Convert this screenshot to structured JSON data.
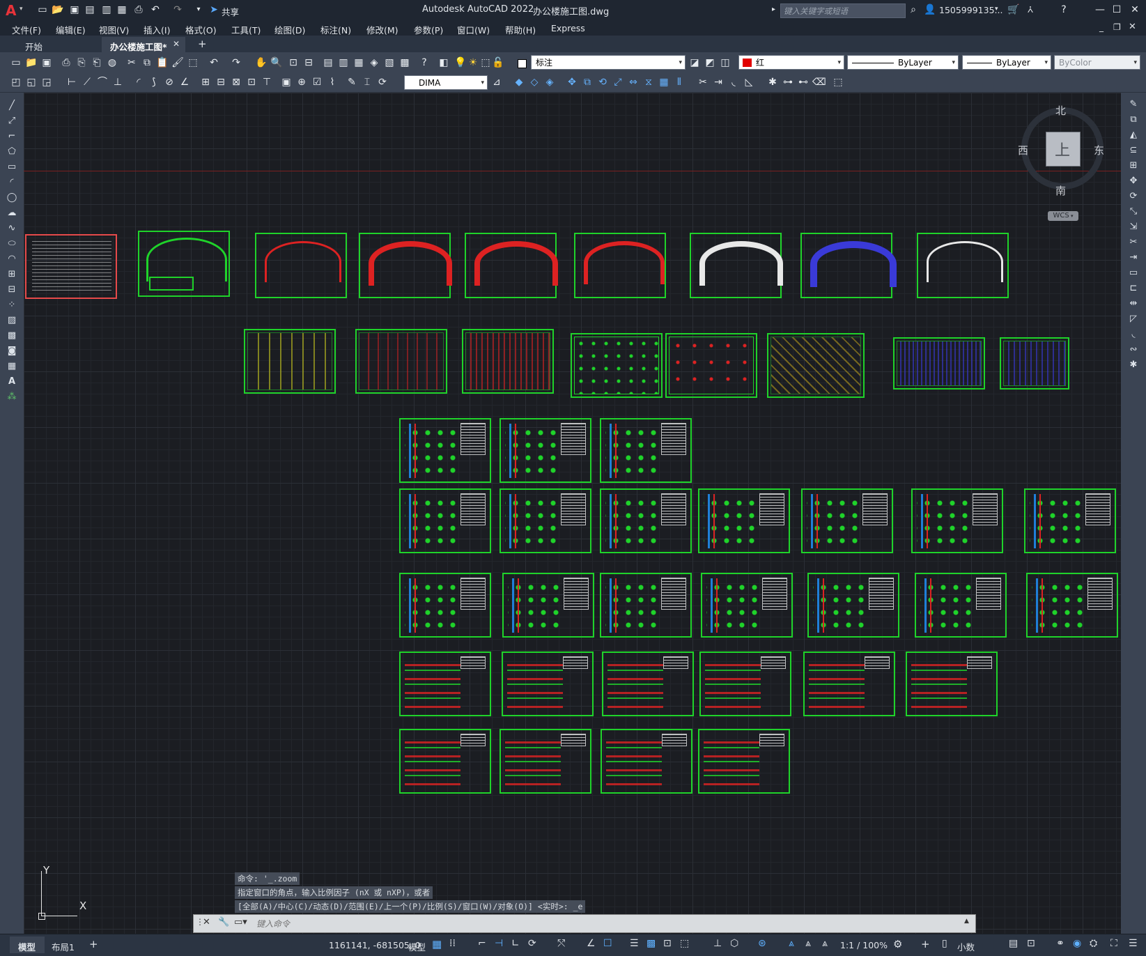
{
  "app": {
    "title": "Autodesk AutoCAD 2022",
    "filename": "办公楼施工图.dwg",
    "search_placeholder": "键入关键字或短语",
    "user": "1505999135...",
    "share_label": "共享",
    "logo": "A"
  },
  "menu": [
    "文件(F)",
    "编辑(E)",
    "视图(V)",
    "插入(I)",
    "格式(O)",
    "工具(T)",
    "绘图(D)",
    "标注(N)",
    "修改(M)",
    "参数(P)",
    "窗口(W)",
    "帮助(H)",
    "Express"
  ],
  "tabs": [
    {
      "label": "开始",
      "active": false
    },
    {
      "label": "办公楼施工图*",
      "active": true
    }
  ],
  "toolbar": {
    "layer_value": "标注",
    "color_value": "红",
    "linetype_value": "ByLayer",
    "lineweight_value": "ByLayer",
    "plotstyle_value": "ByColor",
    "dimstyle_value": "DIMA"
  },
  "viewcube": {
    "north": "北",
    "south": "南",
    "east": "东",
    "west": "西",
    "face": "上",
    "wcs": "WCS"
  },
  "ucs": {
    "x": "X",
    "y": "Y"
  },
  "command": {
    "history": [
      "命令: '_.zoom",
      "指定窗口的角点，输入比例因子 (nX 或 nXP)，或者",
      "[全部(A)/中心(C)/动态(D)/范围(E)/上一个(P)/比例(S)/窗口(W)/对象(O)] <实时>: _e"
    ],
    "placeholder": "键入命令"
  },
  "status": {
    "model_tab": "模型",
    "layout_tab": "布局1",
    "coords": "1161141, -681505, 0",
    "mode": "模型",
    "scale": "1:1 / 100%",
    "units": "小数"
  },
  "colors": {
    "sheet_border": "#1fd32a",
    "titleblock_border": "#e64a4a",
    "canvas": "#1b1d22",
    "chrome": "#3b4453"
  }
}
